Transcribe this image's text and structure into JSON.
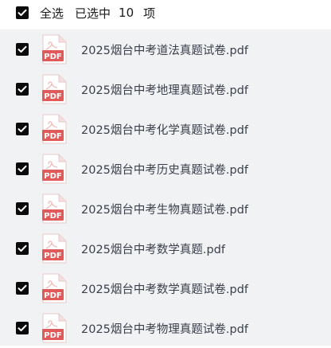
{
  "header": {
    "select_all_label": "全选",
    "selected_label": "已选中",
    "selected_count": "10",
    "selected_unit": "项"
  },
  "pdf_badge": "PDF",
  "files": [
    {
      "name": "2025烟台中考道法真题试卷.pdf",
      "checked": true
    },
    {
      "name": "2025烟台中考地理真题试卷.pdf",
      "checked": true
    },
    {
      "name": "2025烟台中考化学真题试卷.pdf",
      "checked": true
    },
    {
      "name": "2025烟台中考历史真题试卷.pdf",
      "checked": true
    },
    {
      "name": "2025烟台中考生物真题试卷.pdf",
      "checked": true
    },
    {
      "name": "2025烟台中考数学真题.pdf",
      "checked": true
    },
    {
      "name": "2025烟台中考数学真题试卷.pdf",
      "checked": true
    },
    {
      "name": "2025烟台中考物理真题试卷.pdf",
      "checked": true
    }
  ],
  "colors": {
    "checkbox": "#0b0b0b",
    "pdf_red": "#e05a5a",
    "list_background": "#f1f2f4"
  },
  "icons": {
    "checkbox": "check-icon",
    "file": "pdf-file-icon"
  }
}
